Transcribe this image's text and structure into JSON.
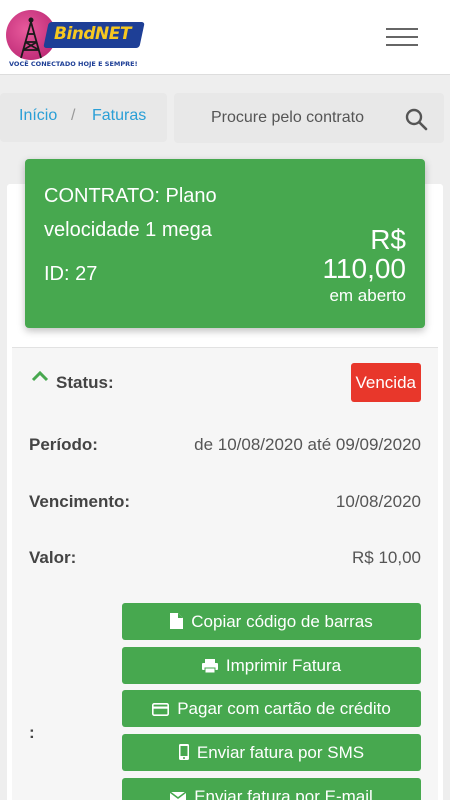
{
  "brand": {
    "logo_text": "BindNET",
    "tagline": "VOCÊ CONECTADO HOJE E SEMPRE!"
  },
  "breadcrumb": {
    "home": "Início",
    "separator": "/",
    "current": "Faturas"
  },
  "search": {
    "placeholder": "Procure pelo contrato"
  },
  "contract": {
    "title": "CONTRATO: Plano velocidade 1 mega",
    "id_label": "ID: 27",
    "currency": "R$",
    "amount": "110,00",
    "amount_status": "em aberto"
  },
  "invoice": {
    "status_label": "Status:",
    "status_value": "Vencida",
    "period_label": "Período:",
    "period_value": "de 10/08/2020 até 09/09/2020",
    "due_label": "Vencimento:",
    "due_value": "10/08/2020",
    "value_label": "Valor:",
    "value_value": "R$ 10,00",
    "actions_label": ":"
  },
  "actions": [
    {
      "label": "Copiar código de barras",
      "icon": "file-icon"
    },
    {
      "label": "Imprimir Fatura",
      "icon": "printer-icon"
    },
    {
      "label": "Pagar com cartão de crédito",
      "icon": "credit-card-icon"
    },
    {
      "label": "Enviar fatura por SMS",
      "icon": "mobile-icon"
    },
    {
      "label": "Enviar fatura por E-mail",
      "icon": "envelope-icon"
    }
  ],
  "colors": {
    "accent_green": "#47a84f",
    "status_red": "#e8372b",
    "link_blue": "#2a9fd6"
  }
}
